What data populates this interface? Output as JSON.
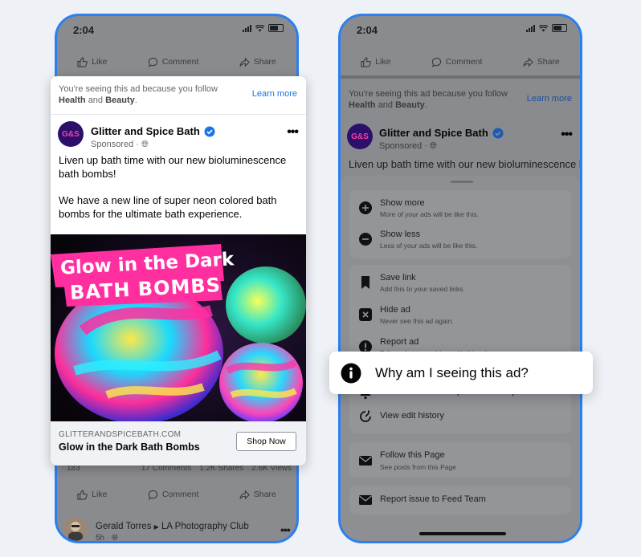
{
  "left_phone": {
    "time": "2:04",
    "actions": {
      "like": "Like",
      "comment": "Comment",
      "share": "Share"
    },
    "ad_card": {
      "why_text_prefix": "You're seeing this ad because you follow",
      "why_interest_1": "Health",
      "why_and": "and",
      "why_interest_2": "Beauty",
      "learn_more": "Learn more",
      "avatar_text": "G&S",
      "page_name": "Glitter and Spice Bath",
      "sponsored": "Sponsored ·",
      "post_text_1": "Liven up bath time with our new bioluminescence bath bombs!",
      "post_text_2": "We have a new line of super neon colored bath bombs for the ultimate bath experience.",
      "image_title_1": "Glow in the Dark",
      "image_title_2": "BATH BOMBS",
      "domain": "GLITTERANDSPICEBATH.COM",
      "headline": "Glow in the Dark Bath Bombs",
      "cta": "Shop Now"
    },
    "stats": {
      "reactions": "183",
      "comments": "17 Comments",
      "shares": "1.2K Shares",
      "views": "2.6K Views"
    },
    "next_post": {
      "user": "Gerald Torres",
      "group": "LA Photography Club",
      "time": "5h ·"
    }
  },
  "right_phone": {
    "time": "2:04",
    "actions": {
      "like": "Like",
      "comment": "Comment",
      "share": "Share"
    },
    "why_text_prefix": "You're seeing this ad because you follow",
    "why_interest_1": "Health",
    "why_and": "and",
    "why_interest_2": "Beauty",
    "learn_more": "Learn more",
    "avatar_text": "G&S",
    "page_name": "Glitter and Spice Bath",
    "sponsored": "Sponsored ·",
    "post_text": "Liven up bath time with our new bioluminescence bath bombs!",
    "sheet": {
      "show_more": {
        "title": "Show more",
        "sub": "More of your ads will be like this."
      },
      "show_less": {
        "title": "Show less",
        "sub": "Less of your ads will be like this."
      },
      "save_link": {
        "title": "Save link",
        "sub": "Add this to your saved links."
      },
      "hide_ad": {
        "title": "Hide ad",
        "sub": "Never see this ad again."
      },
      "report_ad": {
        "title": "Report ad",
        "sub": "Tell us about a problem with this ad"
      },
      "get_notified": {
        "title": "Get notified about updates to this post"
      },
      "view_edit": {
        "title": "View edit history"
      },
      "follow_page": {
        "title": "Follow this Page",
        "sub": "See posts from this Page"
      },
      "report_issue": {
        "title": "Report issue to Feed Team"
      }
    }
  },
  "callout": {
    "label": "Why am I seeing this ad?"
  },
  "colors": {
    "phone_border": "#2d7ff0",
    "link": "#1b74e4",
    "verified": "#1b74e4",
    "accent_pink": "#ff2fa0"
  }
}
